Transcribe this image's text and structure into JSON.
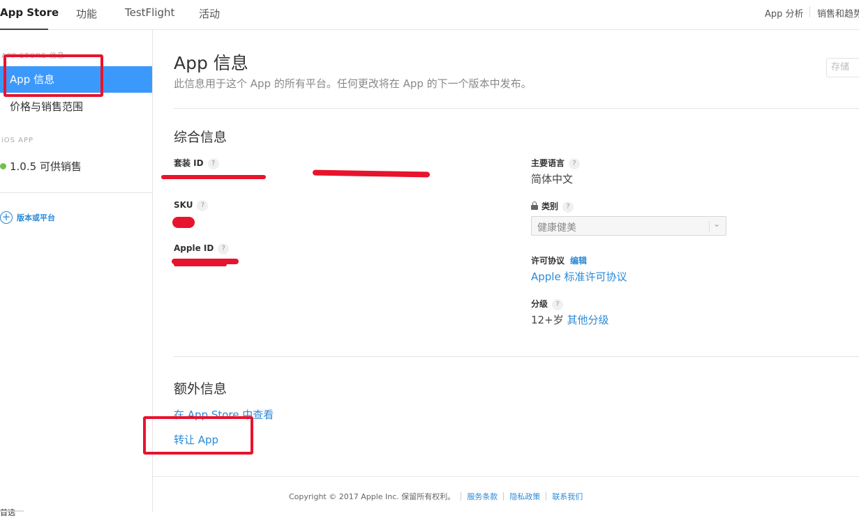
{
  "topnav": {
    "tabs": [
      {
        "label": "App Store",
        "active": true
      },
      {
        "label": "功能"
      },
      {
        "label": "TestFlight"
      },
      {
        "label": "活动"
      }
    ],
    "right_links": [
      "App 分析",
      "销售和趋势"
    ]
  },
  "sidebar": {
    "section_store": "APP STORE 信息",
    "items": [
      {
        "label": "App 信息",
        "selected": true
      },
      {
        "label": "价格与销售范围"
      }
    ],
    "section_ios": "iOS APP",
    "version": {
      "label": "1.0.5 可供销售",
      "status_color": "#70c04a"
    },
    "add_label": "版本或平台",
    "bottom_cut_text": "首选"
  },
  "main": {
    "title": "App 信息",
    "subtitle": "此信息用于这个 App 的所有平台。任何更改将在 App 的下一个版本中发布。",
    "save_label": "存储",
    "general": {
      "title": "综合信息",
      "bundle_id_label": "套装 ID",
      "sku_label": "SKU",
      "apple_id_label": "Apple ID",
      "primary_language_label": "主要语言",
      "primary_language_value": "简体中文",
      "category_label": "类别",
      "category_value": "健康健美",
      "license_label": "许可协议",
      "license_edit": "编辑",
      "license_value": "Apple 标准许可协议",
      "rating_label": "分级",
      "rating_value": "12+岁",
      "rating_link": "其他分级"
    },
    "additional": {
      "title": "额外信息",
      "view_in_store": "在 App Store 中查看",
      "transfer_app": "转让 App"
    }
  },
  "footer": {
    "copyright": "Copyright © 2017 Apple Inc. 保留所有权利。",
    "links": [
      "服务条款",
      "隐私政策",
      "联系我们"
    ]
  },
  "colors": {
    "accent": "#3b99fc",
    "link": "#2a8ad8",
    "annotation": "#e8132d"
  }
}
